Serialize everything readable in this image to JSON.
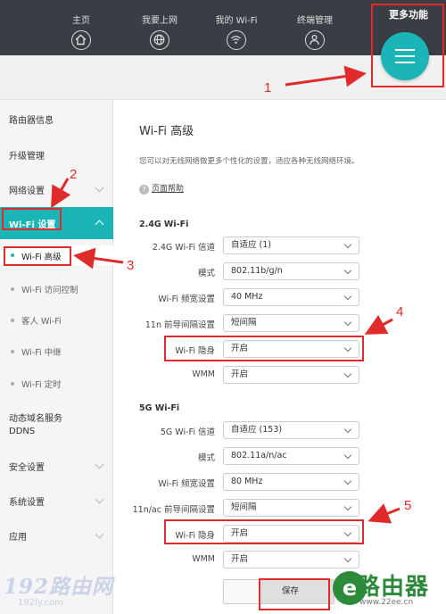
{
  "header": {
    "nav": [
      {
        "label": "主页",
        "icon": "home-icon"
      },
      {
        "label": "我要上网",
        "icon": "globe-icon"
      },
      {
        "label": "我的 Wi-Fi",
        "icon": "wifi-icon"
      },
      {
        "label": "终端管理",
        "icon": "user-icon"
      }
    ],
    "more_label": "更多功能",
    "more_icon": "menu-icon"
  },
  "sidebar": {
    "items": [
      {
        "label": "路由器信息"
      },
      {
        "label": "升级管理"
      },
      {
        "label": "网络设置"
      },
      {
        "label": "Wi-Fi 设置"
      },
      {
        "label": "动态域名服务"
      },
      {
        "label": "DDNS"
      },
      {
        "label": "安全设置"
      },
      {
        "label": "系统设置"
      },
      {
        "label": "应用"
      }
    ],
    "sub_items": [
      {
        "label": "Wi-Fi 高级"
      },
      {
        "label": "Wi-Fi 访问控制"
      },
      {
        "label": "客人 Wi-Fi"
      },
      {
        "label": "Wi-Fi 中继"
      },
      {
        "label": "Wi-Fi 定时"
      }
    ]
  },
  "main": {
    "title": "Wi-Fi 高级",
    "description": "您可以对无线网络做更多个性化的设置，适应各种无线网络环境。",
    "help": "页面帮助",
    "section_24": {
      "title": "2.4G Wi-Fi",
      "rows": [
        {
          "label": "2.4G Wi-Fi 信道",
          "value": "自适应 (1)"
        },
        {
          "label": "模式",
          "value": "802.11b/g/n"
        },
        {
          "label": "Wi-Fi 频宽设置",
          "value": "40 MHz"
        },
        {
          "label": "11n 前导间隔设置",
          "value": "短间隔"
        },
        {
          "label": "Wi-Fi 隐身",
          "value": "开启"
        },
        {
          "label": "WMM",
          "value": "开启"
        }
      ]
    },
    "section_5g": {
      "title": "5G Wi-Fi",
      "rows": [
        {
          "label": "5G Wi-Fi 信道",
          "value": "自适应 (153)"
        },
        {
          "label": "模式",
          "value": "802.11a/n/ac"
        },
        {
          "label": "Wi-Fi 频宽设置",
          "value": "80 MHz"
        },
        {
          "label": "11n/ac 前导间隔设置",
          "value": "短间隔"
        },
        {
          "label": "Wi-Fi 隐身",
          "value": "开启"
        },
        {
          "label": "WMM",
          "value": "开启"
        }
      ]
    },
    "save_label": "保存"
  },
  "annotations": [
    "1",
    "2",
    "3",
    "4",
    "5"
  ],
  "watermarks": {
    "left": "192路由网",
    "left_sub": "192ly.com",
    "right": "路由器",
    "right_sub": "www.22ee.cn"
  },
  "colors": {
    "accent": "#1bb5b7",
    "header": "#3a3d44",
    "annotation": "#e02b2b"
  }
}
